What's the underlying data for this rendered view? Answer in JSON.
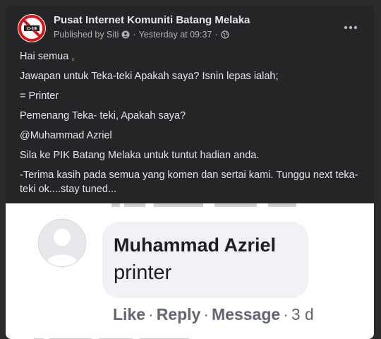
{
  "post": {
    "page_name": "Pusat Internet Komuniti Batang Melaka",
    "published_by": "Published by Siti",
    "separator": "·",
    "time": "Yesterday at 09:37",
    "separator2": "·",
    "avatar_logo_text": "C-19",
    "icons": {
      "author": "user-badge-icon",
      "privacy": "globe-icon",
      "menu": "more-options-icon"
    },
    "paragraphs": [
      "Hai semua ,",
      "Jawapan untuk Teka-teki Apakah saya? Isnin lepas ialah;",
      "= Printer",
      "Pemenang Teka- teki, Apakah saya?",
      "@Muhammad Azriel",
      "Sila ke PIK Batang Melaka untuk tuntut hadian anda.",
      "-Terima kasih pada semua yang komen dan sertai kami. Tunggu next teka-teki ok....stay tuned..."
    ]
  },
  "comment_screenshot": {
    "commenter": "Muhammad Azriel",
    "text": "printer",
    "actions": {
      "like": "Like",
      "reply": "Reply",
      "message": "Message",
      "sep": "·",
      "time": "3 d"
    }
  },
  "colors": {
    "card_bg": "#242526",
    "primary_text": "#e4e6eb",
    "secondary_text": "#b0b3b8",
    "logo_red": "#d7141a"
  }
}
